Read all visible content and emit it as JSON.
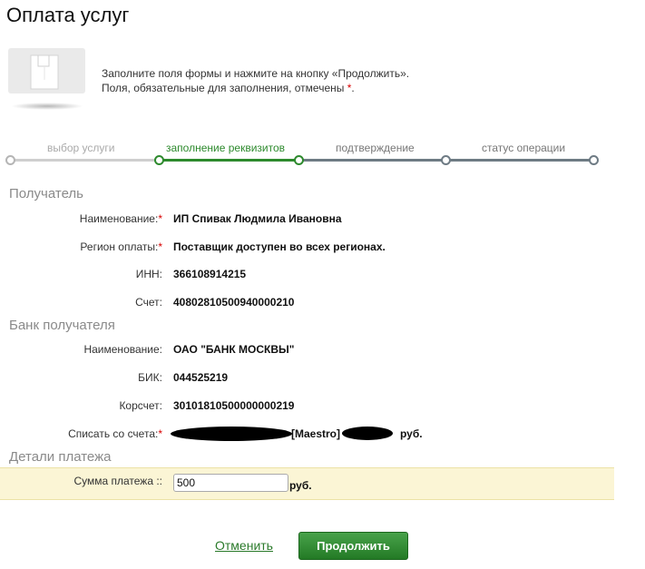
{
  "page": {
    "title": "Оплата услуг"
  },
  "info": {
    "line1": "Заполните поля формы и нажмите на кнопку «Продолжить».",
    "line2_prefix": "Поля, обязательные для заполнения, отмечены",
    "required_mark": "*",
    "line2_suffix": "."
  },
  "steps": [
    {
      "label": "выбор услуги",
      "state": "done"
    },
    {
      "label": "заполнение реквизитов",
      "state": "active"
    },
    {
      "label": "подтверждение",
      "state": "pending"
    },
    {
      "label": "статус операции",
      "state": "pending"
    }
  ],
  "recipient": {
    "heading": "Получатель",
    "name_label": "Наименование:",
    "name_value": "ИП Спивак Людмила Ивановна",
    "region_label": "Регион оплаты:",
    "region_value": "Поставщик доступен во всех регионах.",
    "inn_label": "ИНН:",
    "inn_value": "366108914215",
    "account_label": "Счет:",
    "account_value": "40802810500940000210"
  },
  "bank": {
    "heading": "Банк получателя",
    "name_label": "Наименование:",
    "name_value": "ОАО \"БАНК МОСКВЫ\"",
    "bik_label": "БИК:",
    "bik_value": "044525219",
    "corr_label": "Корсчет:",
    "corr_value": "30101810500000000219"
  },
  "debit": {
    "label": "Списать со счета:",
    "card_type": "[Maestro]",
    "currency": "руб."
  },
  "details": {
    "heading": "Детали платежа",
    "amount_label": "Сумма платежа ::",
    "amount_value": "500",
    "currency": "руб."
  },
  "actions": {
    "cancel": "Отменить",
    "continue": "Продолжить"
  },
  "colors": {
    "accent_green": "#2d8a2d",
    "step_gray": "#6e7b84",
    "required_red": "#d80000",
    "highlight_row": "#fbf5d5"
  }
}
